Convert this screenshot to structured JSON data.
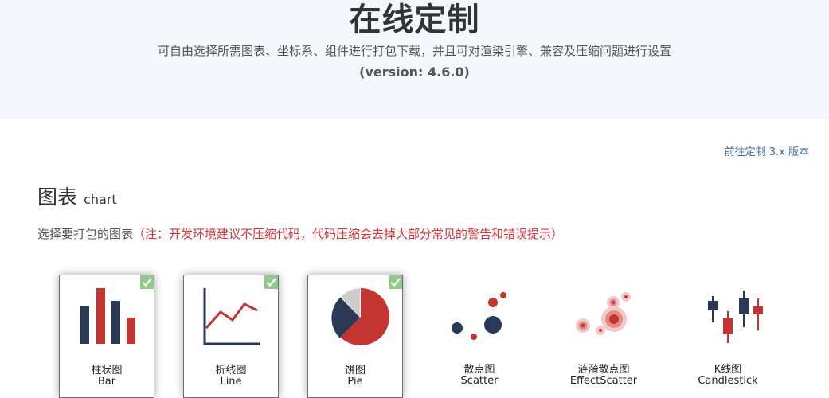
{
  "header": {
    "title": "在线定制",
    "description": "可自由选择所需图表、坐标系、组件进行打包下载，并且可对渲染引擎、兼容及压缩问题进行设置",
    "version": "(version: 4.6.0)"
  },
  "links": {
    "v3": "前往定制 3.x 版本"
  },
  "section": {
    "title_cn": "图表",
    "title_en": "chart",
    "note": "选择要打包的图表",
    "warning": "（注：开发环境建议不压缩代码，代码压缩会去掉大部分常见的警告和错误提示）"
  },
  "charts": [
    {
      "name_cn": "柱状图",
      "name_en": "Bar",
      "selected": true,
      "icon": "bar-chart-icon"
    },
    {
      "name_cn": "折线图",
      "name_en": "Line",
      "selected": true,
      "icon": "line-chart-icon"
    },
    {
      "name_cn": "饼图",
      "name_en": "Pie",
      "selected": true,
      "icon": "pie-chart-icon"
    },
    {
      "name_cn": "散点图",
      "name_en": "Scatter",
      "selected": false,
      "icon": "scatter-chart-icon"
    },
    {
      "name_cn": "涟漪散点图",
      "name_en": "EffectScatter",
      "selected": false,
      "icon": "effect-scatter-chart-icon"
    },
    {
      "name_cn": "K线图",
      "name_en": "Candlestick",
      "selected": false,
      "icon": "candlestick-chart-icon"
    }
  ],
  "colors": {
    "navy": "#2a3a54",
    "red": "#c23531",
    "gray": "#cccccc",
    "check": "#91c98c",
    "link": "#3a6b9b",
    "warning": "#d0383e"
  }
}
